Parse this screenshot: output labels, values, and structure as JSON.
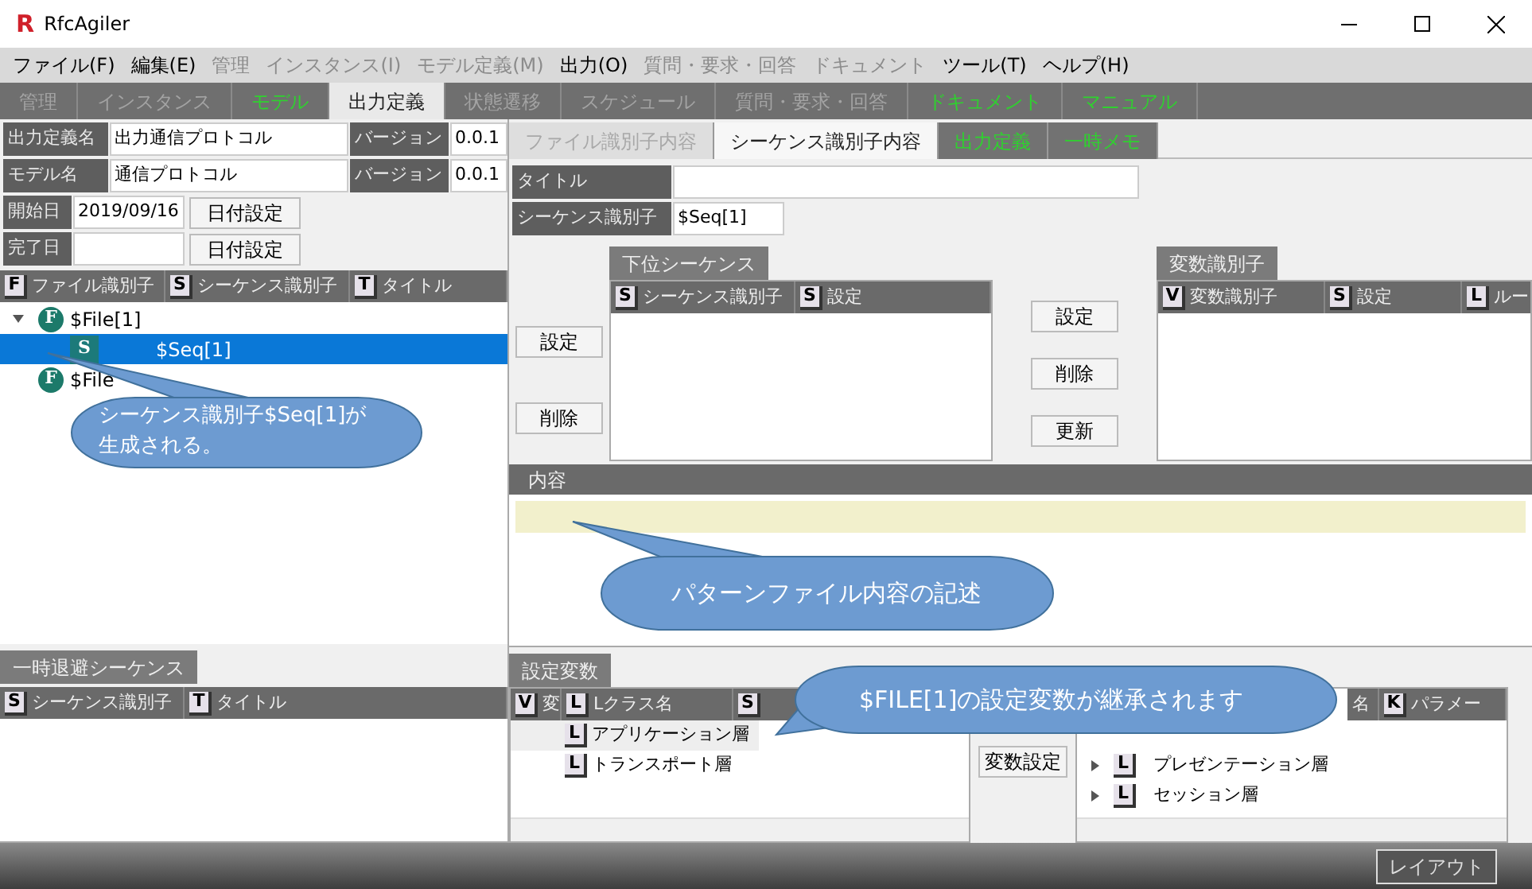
{
  "window": {
    "title": "RfcAgiler",
    "logo": "R"
  },
  "menu": [
    {
      "label": "ファイル(F)",
      "disabled": false
    },
    {
      "label": "編集(E)",
      "disabled": false
    },
    {
      "label": "管理",
      "disabled": true
    },
    {
      "label": "インスタンス(I)",
      "disabled": true
    },
    {
      "label": "モデル定義(M)",
      "disabled": true
    },
    {
      "label": "出力(O)",
      "disabled": false
    },
    {
      "label": "質問・要求・回答",
      "disabled": true
    },
    {
      "label": "ドキュメント",
      "disabled": true
    },
    {
      "label": "ツール(T)",
      "disabled": false
    },
    {
      "label": "ヘルプ(H)",
      "disabled": false
    }
  ],
  "main_tabs": [
    {
      "label": "管理",
      "selected": false,
      "enabled": false
    },
    {
      "label": "インスタンス",
      "selected": false,
      "enabled": false
    },
    {
      "label": "モデル",
      "selected": false,
      "enabled": true
    },
    {
      "label": "出力定義",
      "selected": true,
      "enabled": true
    },
    {
      "label": "状態遷移",
      "selected": false,
      "enabled": false
    },
    {
      "label": "スケジュール",
      "selected": false,
      "enabled": false
    },
    {
      "label": "質問・要求・回答",
      "selected": false,
      "enabled": false
    },
    {
      "label": "ドキュメント",
      "selected": false,
      "enabled": true
    },
    {
      "label": "マニュアル",
      "selected": false,
      "enabled": true
    }
  ],
  "form": {
    "output_name_label": "出力定義名",
    "output_name": "出力通信プロトコル",
    "version_label": "バージョン",
    "version": "0.0.1",
    "model_label": "モデル名",
    "model_name": "通信プロトコル",
    "model_version_label": "バージョン",
    "model_version": "0.0.1",
    "start_label": "開始日",
    "start_date": "2019/09/16",
    "start_button": "日付設定",
    "end_label": "完了日",
    "end_button": "日付設定"
  },
  "tree": {
    "columns": [
      {
        "badge": "F",
        "label": "ファイル識別子"
      },
      {
        "badge": "S",
        "label": "シーケンス識別子"
      },
      {
        "badge": "T",
        "label": "タイトル"
      }
    ],
    "items": [
      {
        "badge": "F",
        "label": "$File[1]",
        "selected": false,
        "expanded": true,
        "children": [
          {
            "badge": "S",
            "label": "$Seq[1]",
            "selected": true
          }
        ]
      },
      {
        "badge": "F",
        "label": "$File",
        "selected": false
      }
    ]
  },
  "temp_sequences": {
    "tab": "一時退避シーケンス",
    "columns": [
      {
        "badge": "S",
        "label": "シーケンス識別子"
      },
      {
        "badge": "T",
        "label": "タイトル"
      }
    ]
  },
  "sub_tabs": [
    {
      "label": "ファイル識別子内容",
      "selected": false,
      "enabled": false
    },
    {
      "label": "シーケンス識別子内容",
      "selected": true,
      "enabled": true
    },
    {
      "label": "出力定義",
      "selected": false,
      "enabled": true
    },
    {
      "label": "一時メモ",
      "selected": false,
      "enabled": true
    }
  ],
  "sequence_form": {
    "title_label": "タイトル",
    "seq_label": "シーケンス識別子",
    "seq_value": "$Seq[1]"
  },
  "left_buttons": [
    "設定",
    "削除"
  ],
  "sub_sequences": {
    "tab": "下位シーケンス",
    "columns": [
      {
        "badge": "S",
        "label": "シーケンス識別子"
      },
      {
        "badge": "S",
        "label": "設定"
      }
    ]
  },
  "mid_buttons": [
    "設定",
    "削除",
    "更新"
  ],
  "variables": {
    "tab": "変数識別子",
    "columns": [
      {
        "badge": "V",
        "label": "変数識別子"
      },
      {
        "badge": "S",
        "label": "設定"
      },
      {
        "badge": "L",
        "label": "ルー"
      }
    ]
  },
  "content": {
    "header": "内容"
  },
  "setting_vars": {
    "tab": "設定変数",
    "columns": [
      {
        "badge": "V",
        "label": "変"
      },
      {
        "badge": "L",
        "label": "Lクラス名"
      },
      {
        "badge": "S"
      }
    ],
    "rows": [
      {
        "badge": "L",
        "label": "アプリケーション層",
        "selected": true
      },
      {
        "badge": "L",
        "label": "トランスポート層",
        "selected": false
      }
    ]
  },
  "variable_button": "変数設定",
  "model": {
    "columns": [
      {
        "label": "名"
      },
      {
        "badge": "K",
        "label": "パラメー"
      }
    ],
    "items": [
      {
        "badge": "L",
        "label": "プレゼンテーション層",
        "expanded": false
      },
      {
        "badge": "L",
        "label": "セッション層",
        "expanded": false
      }
    ]
  },
  "layout_button": "レイアウト",
  "callouts": [
    {
      "lines": [
        "シーケンス識別子$Seq[1]が",
        "生成される。"
      ]
    },
    {
      "lines": [
        "パターンファイル内容の記述"
      ]
    },
    {
      "lines": [
        "$FILE[1]の設定変数が継承されます"
      ]
    }
  ]
}
